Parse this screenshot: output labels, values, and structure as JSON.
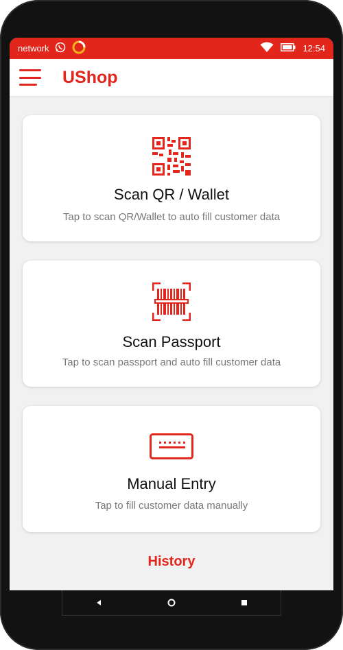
{
  "status_bar": {
    "network_label": "network",
    "time": "12:54",
    "icons": [
      "whatsapp-icon",
      "sync-ring-icon",
      "wifi-icon",
      "battery-icon"
    ]
  },
  "app_bar": {
    "title": "UShop",
    "menu_icon": "hamburger-menu-icon"
  },
  "cards": [
    {
      "icon": "qr-code-icon",
      "title": "Scan QR / Wallet",
      "subtitle": "Tap to scan QR/Wallet to auto fill customer data"
    },
    {
      "icon": "barcode-scan-icon",
      "title": "Scan Passport",
      "subtitle": "Tap to scan passport and auto fill customer data"
    },
    {
      "icon": "keyboard-icon",
      "title": "Manual Entry",
      "subtitle": "Tap to fill customer data manually"
    }
  ],
  "history_link": "History",
  "nav_bar": {
    "buttons": [
      "back-icon",
      "home-icon",
      "recents-icon"
    ]
  },
  "colors": {
    "accent": "#e3261c",
    "background": "#f1f1f1",
    "card": "#ffffff"
  }
}
